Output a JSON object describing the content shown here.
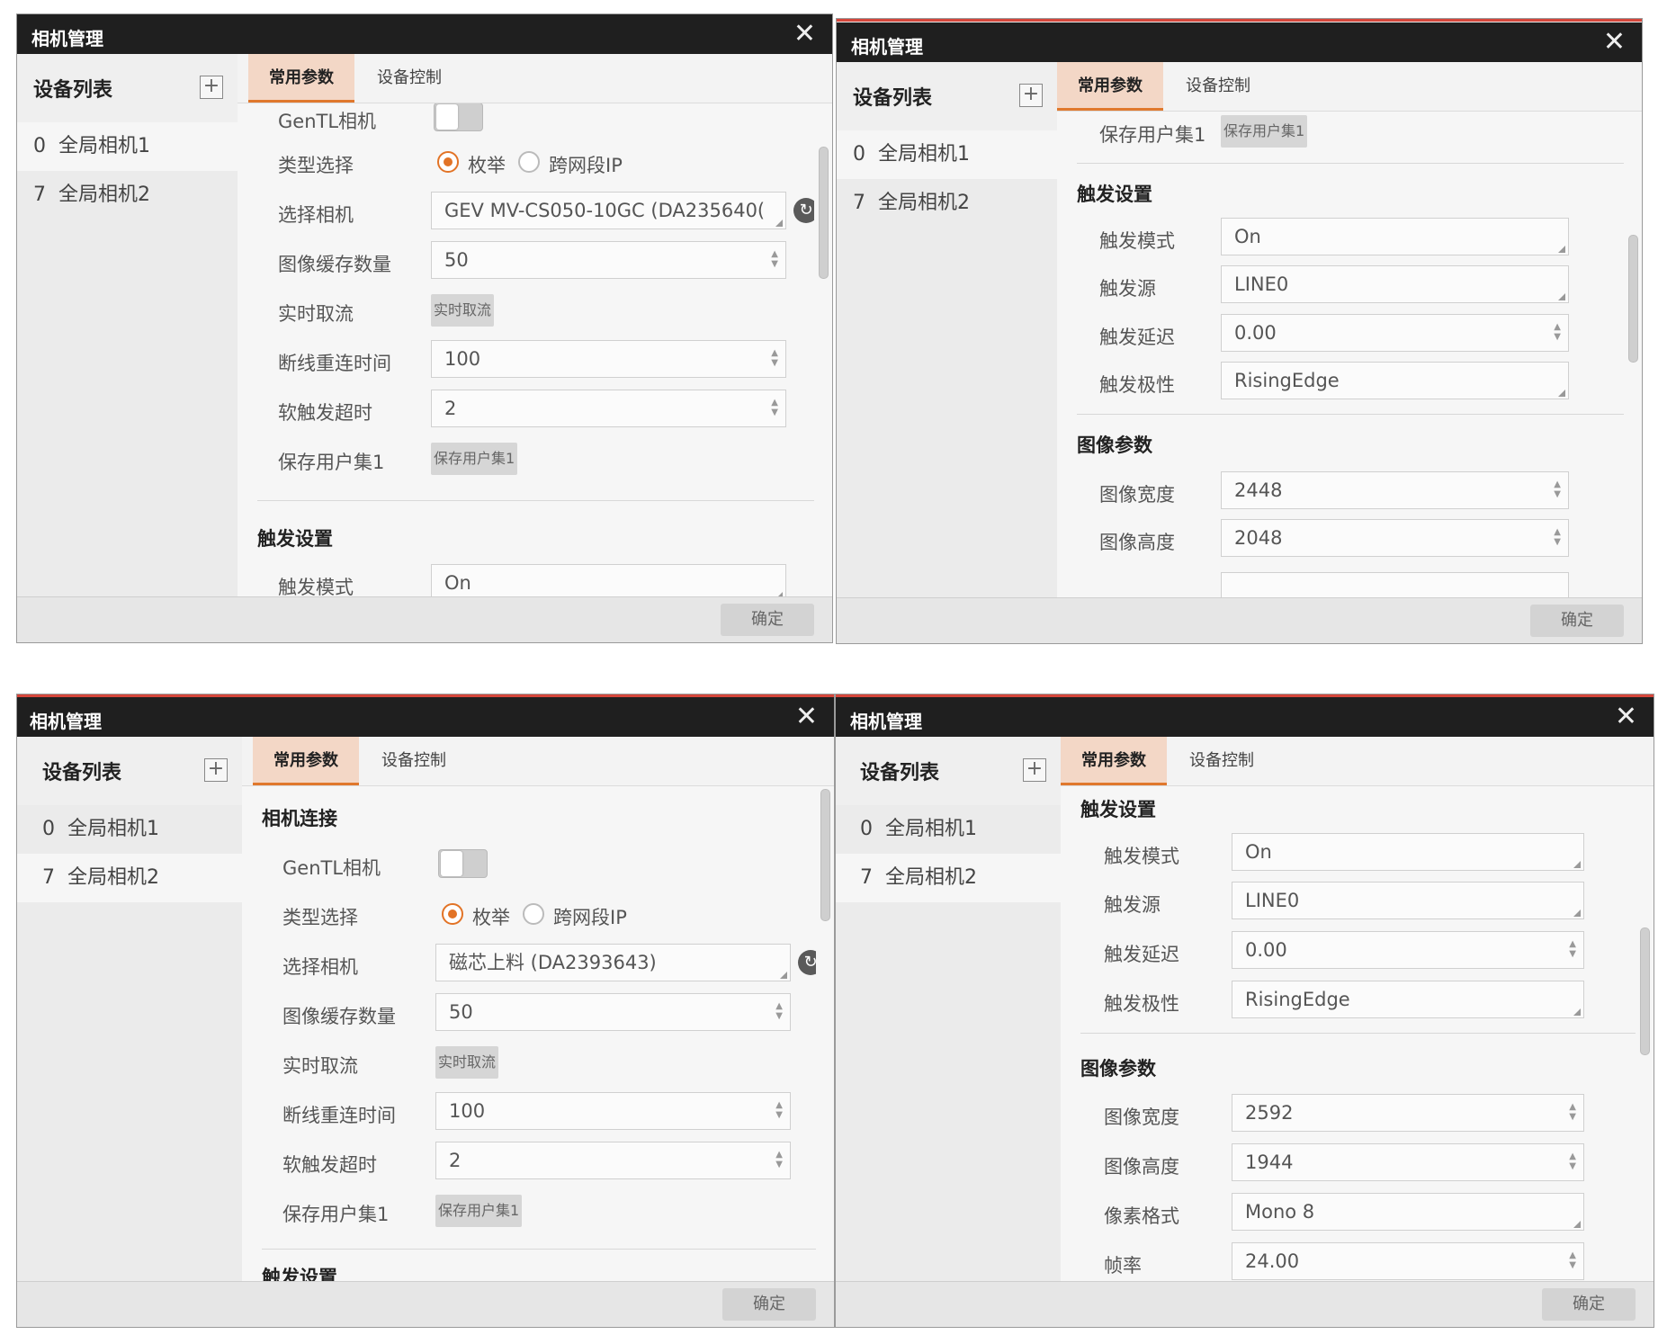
{
  "window_title": "相机管理",
  "close_glyph": "✕",
  "sidebar": {
    "title": "设备列表",
    "add_glyph": "+",
    "devices": [
      {
        "index": "0",
        "name": "全局相机1"
      },
      {
        "index": "7",
        "name": "全局相机2"
      }
    ]
  },
  "tabs": [
    "常用参数",
    "设备控制"
  ],
  "footer": {
    "ok_label": "确定"
  },
  "sections": {
    "connect": "相机连接",
    "trigger": "触发设置",
    "image": "图像参数"
  },
  "labels": {
    "gentl": "GenTL相机",
    "type_select": "类型选择",
    "enum": "枚举",
    "cross_subnet": "跨网段IP",
    "select_camera": "选择相机",
    "buffer_count": "图像缓存数量",
    "realtime_grab": "实时取流",
    "reconnect_time": "断线重连时间",
    "soft_trigger_timeout": "软触发超时",
    "save_userset1": "保存用户集1",
    "trigger_mode": "触发模式",
    "trigger_source": "触发源",
    "trigger_delay": "触发延迟",
    "trigger_polarity": "触发极性",
    "image_width": "图像宽度",
    "image_height": "图像高度",
    "pixel_format": "像素格式",
    "frame_rate": "帧率",
    "cut_trigger_section": "触发设置"
  },
  "buttons": {
    "realtime_grab": "实时取流",
    "save_userset1": "保存用户集1"
  },
  "colors": {
    "accent": "#e0782d",
    "titlebar": "#1f1f1f",
    "close_accent": "#d5463b"
  },
  "icons": {
    "refresh": "↻",
    "spin": "▲▼"
  },
  "panels": [
    {
      "id": "top-left",
      "selected_device": 0,
      "values": {
        "camera": "GEV MV-CS050-10GC (DA235640(",
        "buffer": "50",
        "reconnect": "100",
        "soft_timeout": "2",
        "trigger_mode": "On"
      }
    },
    {
      "id": "top-right",
      "selected_device": 0,
      "values": {
        "trigger_mode": "On",
        "trigger_source": "LINE0",
        "trigger_delay": "0.00",
        "trigger_polarity": "RisingEdge",
        "width": "2448",
        "height": "2048"
      }
    },
    {
      "id": "bottom-left",
      "selected_device": 1,
      "values": {
        "camera": "磁芯上料 (DA2393643)",
        "buffer": "50",
        "reconnect": "100",
        "soft_timeout": "2"
      }
    },
    {
      "id": "bottom-right",
      "selected_device": 1,
      "values": {
        "trigger_mode": "On",
        "trigger_source": "LINE0",
        "trigger_delay": "0.00",
        "trigger_polarity": "RisingEdge",
        "width": "2592",
        "height": "1944",
        "pixel_format": "Mono 8",
        "frame_rate": "24.00"
      }
    }
  ]
}
